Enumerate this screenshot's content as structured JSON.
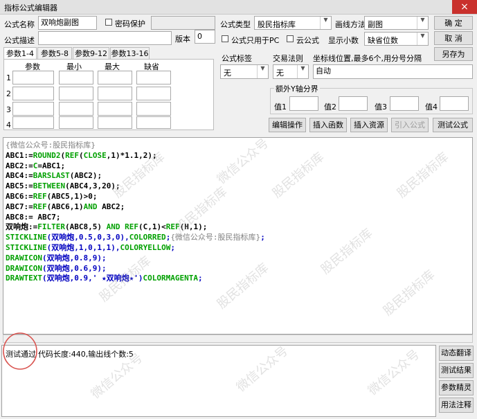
{
  "window": {
    "title": "指标公式编辑器",
    "close_glyph": "×"
  },
  "header": {
    "name_label": "公式名称",
    "name_value": "双响炮副图",
    "password_label": "密码保护",
    "desc_label": "公式描述",
    "version_label": "版本",
    "version_value": "0",
    "type_label": "公式类型",
    "type_value": "股民指标库",
    "draw_label": "画线方法",
    "draw_value": "副图",
    "pc_only_label": "公式只用于PC",
    "cloud_label": "云公式",
    "decimals_label": "显示小数",
    "decimals_value": "缺省位数"
  },
  "buttons": {
    "ok": "确 定",
    "cancel": "取 消",
    "saveas": "另存为"
  },
  "tabs": [
    "参数1-4",
    "参数5-8",
    "参数9-12",
    "参数13-16"
  ],
  "params": {
    "headers": [
      "参数",
      "最小",
      "最大",
      "缺省"
    ],
    "rows": [
      "1",
      "2",
      "3",
      "4"
    ]
  },
  "right_panel": {
    "tag_label": "公式标签",
    "tag_value": "无",
    "rule_label": "交易法则",
    "rule_value": "无",
    "coord_label": "坐标线位置,最多6个,用分号分隔",
    "coord_value": "自动",
    "extra_y_title": "额外Y轴分界",
    "val_labels": [
      "值1",
      "值2",
      "值3",
      "值4"
    ]
  },
  "action_buttons": [
    "编辑操作",
    "插入函数",
    "插入资源",
    "引入公式",
    "测试公式"
  ],
  "code_lines": [
    [
      {
        "t": "{微信公众号:股民指标库}",
        "c": "com"
      }
    ],
    [
      {
        "t": "ABC1:=",
        "c": "def"
      },
      {
        "t": "ROUND2",
        "c": "fn"
      },
      {
        "t": "(",
        "c": "def"
      },
      {
        "t": "REF",
        "c": "fn"
      },
      {
        "t": "(",
        "c": "def"
      },
      {
        "t": "CLOSE",
        "c": "fn"
      },
      {
        "t": ",1)*1.1,2);",
        "c": "def"
      }
    ],
    [
      {
        "t": "ABC2:=",
        "c": "def"
      },
      {
        "t": "C",
        "c": "fn"
      },
      {
        "t": "=ABC1;",
        "c": "def"
      }
    ],
    [
      {
        "t": "ABC4:=",
        "c": "def"
      },
      {
        "t": "BARSLAST",
        "c": "fn"
      },
      {
        "t": "(ABC2);",
        "c": "def"
      }
    ],
    [
      {
        "t": "ABC5:=",
        "c": "def"
      },
      {
        "t": "BETWEEN",
        "c": "fn"
      },
      {
        "t": "(ABC4,3,20);",
        "c": "def"
      }
    ],
    [
      {
        "t": "ABC6:=",
        "c": "def"
      },
      {
        "t": "REF",
        "c": "fn"
      },
      {
        "t": "(ABC5,1)>0;",
        "c": "def"
      }
    ],
    [
      {
        "t": "ABC7:=",
        "c": "def"
      },
      {
        "t": "REF",
        "c": "fn"
      },
      {
        "t": "(ABC6,1)",
        "c": "def"
      },
      {
        "t": "AND",
        "c": "fn"
      },
      {
        "t": " ABC2;",
        "c": "def"
      }
    ],
    [
      {
        "t": "ABC8:= ABC7;",
        "c": "def"
      }
    ],
    [
      {
        "t": "双响炮:=",
        "c": "def"
      },
      {
        "t": "FILTER",
        "c": "fn"
      },
      {
        "t": "(ABC8,5) ",
        "c": "def"
      },
      {
        "t": "AND",
        "c": "fn"
      },
      {
        "t": " ",
        "c": "def"
      },
      {
        "t": "REF",
        "c": "fn"
      },
      {
        "t": "(C,1)<",
        "c": "def"
      },
      {
        "t": "REF",
        "c": "fn"
      },
      {
        "t": "(H,1);",
        "c": "def"
      }
    ],
    [
      {
        "t": "STICKLINE",
        "c": "fn"
      },
      {
        "t": "(双响炮,0.5,0,3,0),",
        "c": "draw"
      },
      {
        "t": "COLORRED",
        "c": "fn"
      },
      {
        "t": ";",
        "c": "draw"
      },
      {
        "t": "{微信公众号:股民指标库}",
        "c": "com"
      },
      {
        "t": ";",
        "c": "draw"
      }
    ],
    [
      {
        "t": "STICKLINE",
        "c": "fn"
      },
      {
        "t": "(双响炮,1,0,1,1),",
        "c": "draw"
      },
      {
        "t": "COLORYELLOW",
        "c": "fn"
      },
      {
        "t": ";",
        "c": "draw"
      }
    ],
    [
      {
        "t": "DRAWICON",
        "c": "fn"
      },
      {
        "t": "(双响炮,0.8,9);",
        "c": "draw"
      }
    ],
    [
      {
        "t": "DRAWICON",
        "c": "fn"
      },
      {
        "t": "(双响炮,0.6,9);",
        "c": "draw"
      }
    ],
    [
      {
        "t": "DRAWTEXT",
        "c": "fn"
      },
      {
        "t": "(双响炮,0.9,' ★双响炮★')",
        "c": "draw"
      },
      {
        "t": "COLORMAGENTA",
        "c": "fn"
      },
      {
        "t": ";",
        "c": "draw"
      }
    ]
  ],
  "code_colors": {
    "def": "#000000",
    "fn": "#00a000",
    "com": "#808080",
    "draw": "#0000c0"
  },
  "status": {
    "test_result": "测试通过",
    "detail": "代码长度:440,输出线个数:5",
    "circle_color": "#d9534f"
  },
  "side_buttons": [
    "动态翻译",
    "测试结果",
    "参数精灵",
    "用法注释"
  ],
  "watermarks": [
    "股民指标库",
    "微信公众号"
  ]
}
